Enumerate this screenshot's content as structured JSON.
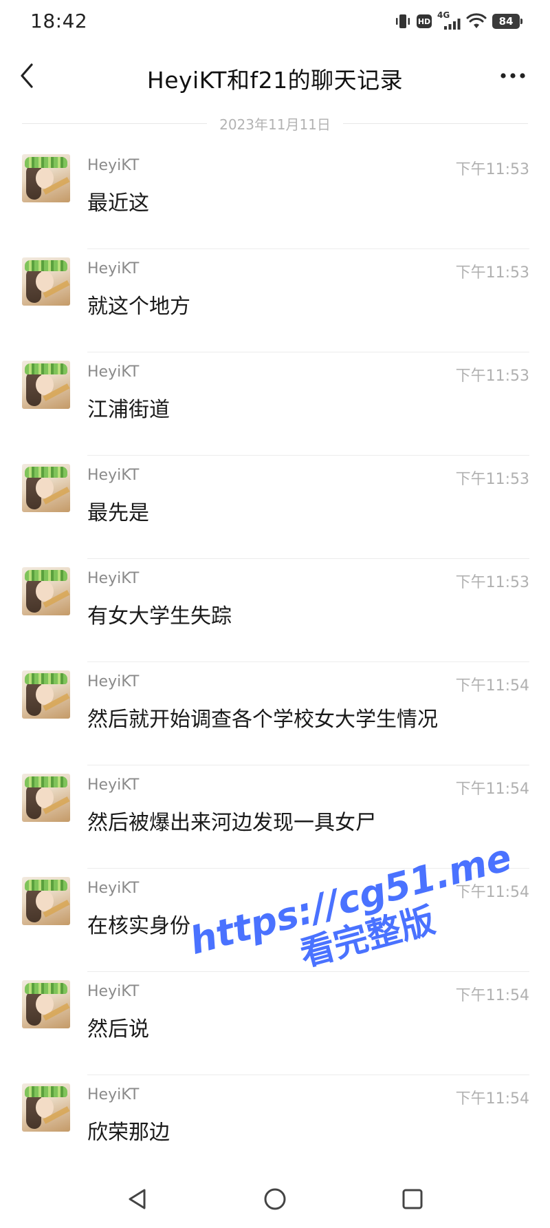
{
  "status_bar": {
    "time": "18:42",
    "hd_label": "HD",
    "network_label": "4G",
    "battery_level": "84"
  },
  "header": {
    "title": "HeyiKT和f21的聊天记录"
  },
  "date_divider": "2023年11月11日",
  "messages": [
    {
      "sender": "HeyiKT",
      "time": "下午11:53",
      "text": "最近这"
    },
    {
      "sender": "HeyiKT",
      "time": "下午11:53",
      "text": "就这个地方"
    },
    {
      "sender": "HeyiKT",
      "time": "下午11:53",
      "text": "江浦街道"
    },
    {
      "sender": "HeyiKT",
      "time": "下午11:53",
      "text": "最先是"
    },
    {
      "sender": "HeyiKT",
      "time": "下午11:53",
      "text": "有女大学生失踪"
    },
    {
      "sender": "HeyiKT",
      "time": "下午11:54",
      "text": "然后就开始调查各个学校女大学生情况"
    },
    {
      "sender": "HeyiKT",
      "time": "下午11:54",
      "text": "然后被爆出来河边发现一具女尸"
    },
    {
      "sender": "HeyiKT",
      "time": "下午11:54",
      "text": "在核实身份"
    },
    {
      "sender": "HeyiKT",
      "time": "下午11:54",
      "text": "然后说"
    },
    {
      "sender": "HeyiKT",
      "time": "下午11:54",
      "text": "欣荣那边"
    }
  ],
  "watermark": {
    "line1": "https://cg51.me",
    "line2": "看完整版"
  },
  "colors": {
    "watermark": "#4a72ff",
    "time_text": "#b0b0b0",
    "sender_text": "#8a8a8a"
  }
}
